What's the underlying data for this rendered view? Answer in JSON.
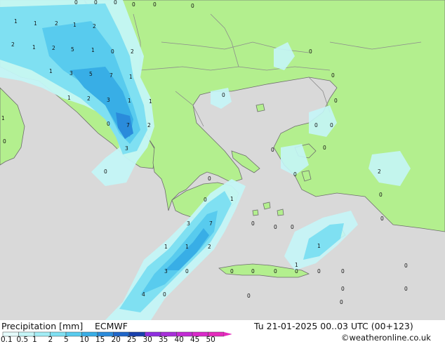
{
  "title": "Precipitation [mm]",
  "model": "ECMWF",
  "valid_time": "Tu 21-01-2025 00..03 UTC (00+123)",
  "credit": "©weatheronline.co.uk",
  "colors": {
    "sea": "#d9d9d9",
    "land": "#b3ef8e",
    "border": "#8c8c8c",
    "coast": "#6e6e6e"
  },
  "legend": [
    {
      "label": "0.1",
      "color": "#e4fbfb"
    },
    {
      "label": "0.5",
      "color": "#c4f5f7"
    },
    {
      "label": "1",
      "color": "#a2edf5"
    },
    {
      "label": "2",
      "color": "#7fe0f2"
    },
    {
      "label": "5",
      "color": "#58cbee"
    },
    {
      "label": "10",
      "color": "#38aee6"
    },
    {
      "label": "15",
      "color": "#2a8bdb"
    },
    {
      "label": "20",
      "color": "#1f66c8"
    },
    {
      "label": "25",
      "color": "#183fad"
    },
    {
      "label": "30",
      "color": "#8f2ee0"
    },
    {
      "label": "35",
      "color": "#a72ed9"
    },
    {
      "label": "40",
      "color": "#c22ad4"
    },
    {
      "label": "45",
      "color": "#d928c9"
    },
    {
      "label": "50",
      "color": "#e52bbd"
    }
  ],
  "point_values": [
    {
      "v": "0"
    },
    {
      "v": "0"
    },
    {
      "v": "0"
    },
    {
      "v": "0"
    },
    {
      "v": "0"
    },
    {
      "v": "0"
    },
    {
      "v": "1"
    },
    {
      "v": "1"
    },
    {
      "v": "2"
    },
    {
      "v": "1"
    },
    {
      "v": "2"
    },
    {
      "v": "2"
    },
    {
      "v": "1"
    },
    {
      "v": "2"
    },
    {
      "v": "5"
    },
    {
      "v": "1"
    },
    {
      "v": "0"
    },
    {
      "v": "2"
    },
    {
      "v": "1"
    },
    {
      "v": "3"
    },
    {
      "v": "5"
    },
    {
      "v": "7"
    },
    {
      "v": "1"
    },
    {
      "v": "1"
    },
    {
      "v": "2"
    },
    {
      "v": "3"
    },
    {
      "v": "1"
    },
    {
      "v": "1"
    },
    {
      "v": "1"
    },
    {
      "v": "0"
    },
    {
      "v": "7"
    },
    {
      "v": "2"
    },
    {
      "v": "0"
    },
    {
      "v": "3"
    },
    {
      "v": "0"
    },
    {
      "v": "0"
    },
    {
      "v": "0"
    },
    {
      "v": "0"
    },
    {
      "v": "0"
    },
    {
      "v": "0"
    },
    {
      "v": "0"
    },
    {
      "v": "0"
    },
    {
      "v": "0"
    },
    {
      "v": "1"
    },
    {
      "v": "0"
    },
    {
      "v": "0"
    },
    {
      "v": "0"
    },
    {
      "v": "3"
    },
    {
      "v": "7"
    },
    {
      "v": "1"
    },
    {
      "v": "1"
    },
    {
      "v": "2"
    },
    {
      "v": "1"
    },
    {
      "v": "1"
    },
    {
      "v": "3"
    },
    {
      "v": "0"
    },
    {
      "v": "4"
    },
    {
      "v": "0"
    },
    {
      "v": "0"
    },
    {
      "v": "0"
    },
    {
      "v": "0"
    },
    {
      "v": "0"
    },
    {
      "v": "0"
    },
    {
      "v": "0"
    },
    {
      "v": "0"
    },
    {
      "v": "0"
    },
    {
      "v": "0"
    },
    {
      "v": "0"
    },
    {
      "v": "0"
    },
    {
      "v": "2"
    },
    {
      "v": "0"
    },
    {
      "v": "0"
    },
    {
      "v": "0"
    },
    {
      "v": "0"
    },
    {
      "v": "0"
    }
  ]
}
